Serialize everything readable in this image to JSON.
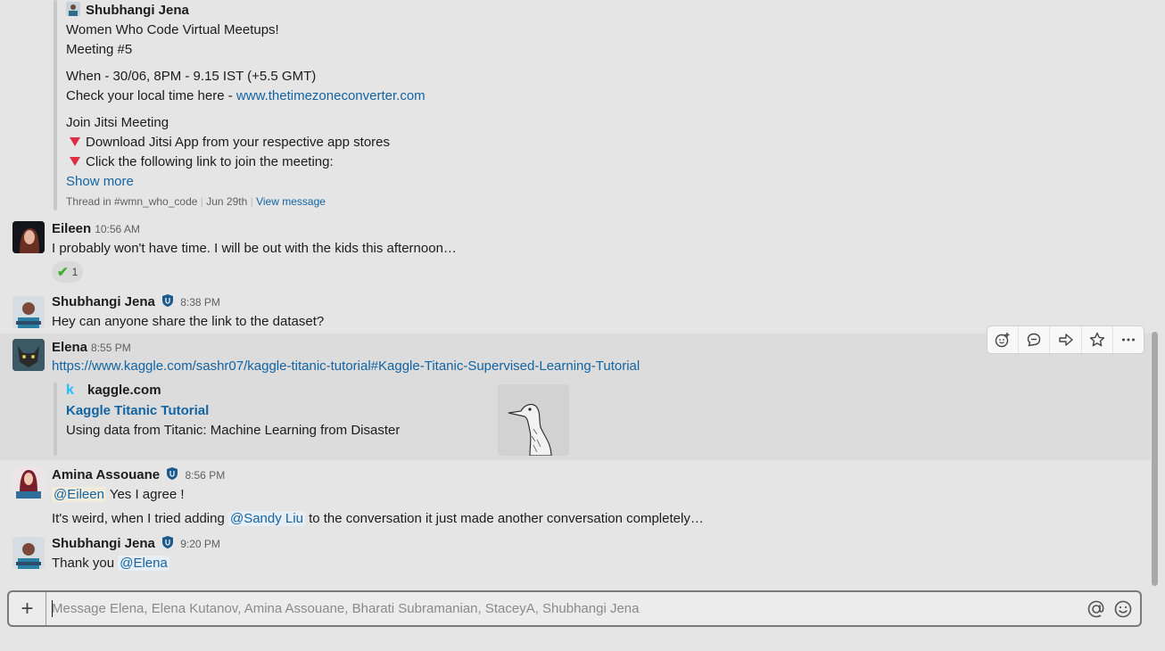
{
  "colors": {
    "background": "#e5e5e5",
    "link": "#1264a3",
    "hover_row": "#dcdcdc"
  },
  "shared_post": {
    "author": "Shubhangi Jena",
    "lines": [
      "Women Who Code Virtual Meetups!",
      "Meeting #5",
      "When - 30/06, 8PM - 9.15  IST (+5.5 GMT)",
      "Check your local time here - ",
      "Join Jitsi Meeting",
      "Download Jitsi App from your respective app stores",
      "Click the following link to join the meeting:"
    ],
    "timezone_link": "www.thetimezoneconverter.com",
    "show_more": "Show more",
    "footer_thread": "Thread in #wmn_who_code",
    "footer_sep": "|",
    "footer_date": "Jun 29th",
    "footer_view": "View message"
  },
  "messages": [
    {
      "author": "Eileen",
      "time": "10:56 AM",
      "text": "I probably won't have time. I will be out with the kids this afternoon…",
      "reaction": {
        "emoji": "✔",
        "count": "1"
      }
    },
    {
      "author": "Shubhangi Jena",
      "time": "8:38 PM",
      "text": "Hey can anyone share the link to the dataset?"
    },
    {
      "author": "Elena",
      "time": "8:55 PM",
      "link": "https://www.kaggle.com/sashr07/kaggle-titanic-tutorial#Kaggle-Titanic-Supervised-Learning-Tutorial",
      "unfurl": {
        "icon": "k",
        "site": "kaggle.com",
        "title": "Kaggle Titanic Tutorial",
        "description": "Using data from Titanic: Machine Learning from Disaster"
      }
    },
    {
      "author": "Amina Assouane",
      "time": "8:56 PM",
      "mention1": "@Eileen",
      "text1": " Yes I agree !",
      "text2a": "It's weird, when I tried adding ",
      "mention2": "@Sandy Liu",
      "text2b": " to the conversation it just made another conversation completely…"
    },
    {
      "author": "Shubhangi Jena",
      "time": "9:20 PM",
      "text": "Thank you ",
      "mention": "@Elena"
    }
  ],
  "toolbar": {
    "icons": [
      "add-reaction-icon",
      "reply-in-thread-icon",
      "share-message-icon",
      "save-star-icon",
      "more-actions-icon"
    ]
  },
  "composer": {
    "placeholder": "Message Elena, Elena Kutanov, Amina Assouane, Bharati Subramanian, StaceyA, Shubhangi Jena",
    "plus": "+"
  }
}
